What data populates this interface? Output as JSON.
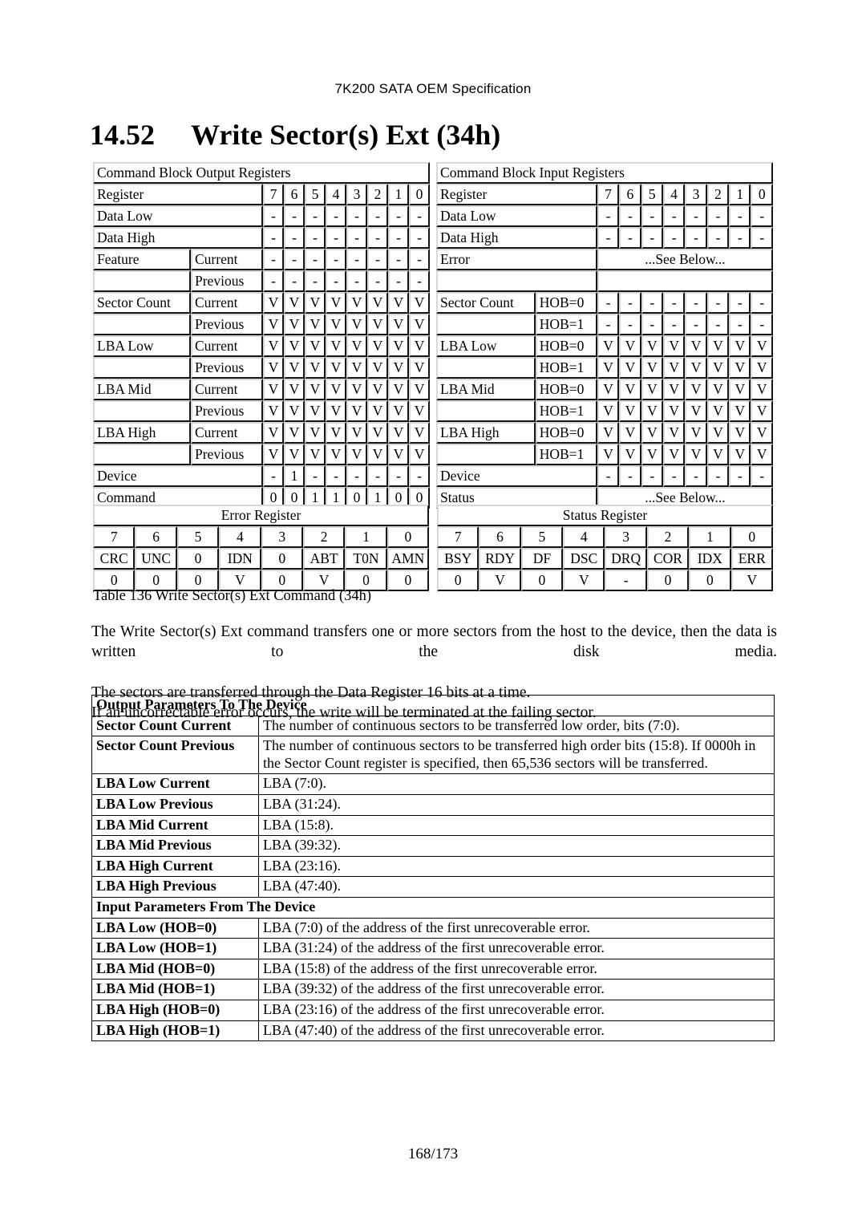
{
  "header": {
    "running_title": "7K200 SATA OEM Specification"
  },
  "title": {
    "number": "14.52",
    "text": "Write Sector(s) Ext (34h)"
  },
  "output_registers": {
    "caption": "Command Block Output Registers",
    "register_label": "Register",
    "bit_headers": [
      "7",
      "6",
      "5",
      "4",
      "3",
      "2",
      "1",
      "0"
    ],
    "rows": [
      {
        "name": "Data Low",
        "sub": "",
        "values": [
          "-",
          "-",
          "-",
          "-",
          "-",
          "-",
          "-",
          "-"
        ]
      },
      {
        "name": "Data High",
        "sub": "",
        "values": [
          "-",
          "-",
          "-",
          "-",
          "-",
          "-",
          "-",
          "-"
        ]
      },
      {
        "name": "Feature",
        "sub": "Current",
        "values": [
          "-",
          "-",
          "-",
          "-",
          "-",
          "-",
          "-",
          "-"
        ]
      },
      {
        "name": "",
        "sub": "Previous",
        "values": [
          "-",
          "-",
          "-",
          "-",
          "-",
          "-",
          "-",
          "-"
        ]
      },
      {
        "name": "Sector Count",
        "sub": "Current",
        "values": [
          "V",
          "V",
          "V",
          "V",
          "V",
          "V",
          "V",
          "V"
        ]
      },
      {
        "name": "",
        "sub": "Previous",
        "values": [
          "V",
          "V",
          "V",
          "V",
          "V",
          "V",
          "V",
          "V"
        ]
      },
      {
        "name": "LBA Low",
        "sub": "Current",
        "values": [
          "V",
          "V",
          "V",
          "V",
          "V",
          "V",
          "V",
          "V"
        ]
      },
      {
        "name": "",
        "sub": "Previous",
        "values": [
          "V",
          "V",
          "V",
          "V",
          "V",
          "V",
          "V",
          "V"
        ]
      },
      {
        "name": "LBA Mid",
        "sub": "Current",
        "values": [
          "V",
          "V",
          "V",
          "V",
          "V",
          "V",
          "V",
          "V"
        ]
      },
      {
        "name": "",
        "sub": "Previous",
        "values": [
          "V",
          "V",
          "V",
          "V",
          "V",
          "V",
          "V",
          "V"
        ]
      },
      {
        "name": "LBA High",
        "sub": "Current",
        "values": [
          "V",
          "V",
          "V",
          "V",
          "V",
          "V",
          "V",
          "V"
        ]
      },
      {
        "name": "",
        "sub": "Previous",
        "values": [
          "V",
          "V",
          "V",
          "V",
          "V",
          "V",
          "V",
          "V"
        ]
      },
      {
        "name": "Device",
        "sub": "",
        "values": [
          "-",
          "1",
          "-",
          "-",
          "-",
          "-",
          "-",
          "-"
        ]
      },
      {
        "name": "Command",
        "sub": "",
        "values": [
          "0",
          "0",
          "1",
          "1",
          "0",
          "1",
          "0",
          "0"
        ]
      }
    ]
  },
  "input_registers": {
    "caption": "Command Block Input Registers",
    "register_label": "Register",
    "bit_headers": [
      "7",
      "6",
      "5",
      "4",
      "3",
      "2",
      "1",
      "0"
    ],
    "see_below": "...See Below...",
    "rows": [
      {
        "name": "Data Low",
        "sub": "",
        "values": [
          "-",
          "-",
          "-",
          "-",
          "-",
          "-",
          "-",
          "-"
        ]
      },
      {
        "name": "Data High",
        "sub": "",
        "values": [
          "-",
          "-",
          "-",
          "-",
          "-",
          "-",
          "-",
          "-"
        ]
      },
      {
        "name": "Error",
        "sub": "",
        "span": "...See Below..."
      },
      {
        "name": "",
        "sub": "",
        "span": ""
      },
      {
        "name": "Sector Count",
        "sub": "HOB=0",
        "values": [
          "-",
          "-",
          "-",
          "-",
          "-",
          "-",
          "-",
          "-"
        ]
      },
      {
        "name": "",
        "sub": "HOB=1",
        "values": [
          "-",
          "-",
          "-",
          "-",
          "-",
          "-",
          "-",
          "-"
        ]
      },
      {
        "name": "LBA Low",
        "sub": "HOB=0",
        "values": [
          "V",
          "V",
          "V",
          "V",
          "V",
          "V",
          "V",
          "V"
        ]
      },
      {
        "name": "",
        "sub": "HOB=1",
        "values": [
          "V",
          "V",
          "V",
          "V",
          "V",
          "V",
          "V",
          "V"
        ]
      },
      {
        "name": "LBA Mid",
        "sub": "HOB=0",
        "values": [
          "V",
          "V",
          "V",
          "V",
          "V",
          "V",
          "V",
          "V"
        ]
      },
      {
        "name": "",
        "sub": "HOB=1",
        "values": [
          "V",
          "V",
          "V",
          "V",
          "V",
          "V",
          "V",
          "V"
        ]
      },
      {
        "name": "LBA High",
        "sub": "HOB=0",
        "values": [
          "V",
          "V",
          "V",
          "V",
          "V",
          "V",
          "V",
          "V"
        ]
      },
      {
        "name": "",
        "sub": "HOB=1",
        "values": [
          "V",
          "V",
          "V",
          "V",
          "V",
          "V",
          "V",
          "V"
        ]
      },
      {
        "name": "Device",
        "sub": "",
        "values": [
          "-",
          "-",
          "-",
          "-",
          "-",
          "-",
          "-",
          "-"
        ]
      },
      {
        "name": "Status",
        "sub": "",
        "span": "...See Below..."
      }
    ]
  },
  "error_register": {
    "title": "Error Register",
    "bits": [
      "7",
      "6",
      "5",
      "4",
      "3",
      "2",
      "1",
      "0"
    ],
    "names": [
      "CRC",
      "UNC",
      "0",
      "IDN",
      "0",
      "ABT",
      "T0N",
      "AMN"
    ],
    "values": [
      "0",
      "0",
      "0",
      "V",
      "0",
      "V",
      "0",
      "0"
    ]
  },
  "status_register": {
    "title": "Status Register",
    "bits": [
      "7",
      "6",
      "5",
      "4",
      "3",
      "2",
      "1",
      "0"
    ],
    "names": [
      "BSY",
      "RDY",
      "DF",
      "DSC",
      "DRQ",
      "COR",
      "IDX",
      "ERR"
    ],
    "values": [
      "0",
      "V",
      "0",
      "V",
      "-",
      "0",
      "0",
      "V"
    ]
  },
  "table_caption": "Table 136 Write Sector(s) Ext Command (34h)",
  "body": {
    "p1": "The Write Sector(s) Ext command transfers one or more sectors from the host to the device, then the data is written to the disk media.",
    "p2": "The sectors are transferred through the Data Register 16 bits at a time.",
    "p3": "If an uncorrectable error occurs, the write will be terminated at the failing sector."
  },
  "parameters": {
    "output_section": "Output Parameters To The Device",
    "output_rows": [
      {
        "key": "Sector Count Current",
        "val": "The number of continuous sectors to be transferred low order, bits (7:0)."
      },
      {
        "key": "Sector Count Previous",
        "val": "The number of continuous sectors to be transferred high order bits (15:8). If 0000h in the Sector Count register is specified, then 65,536 sectors will be transferred."
      },
      {
        "key": "LBA Low Current",
        "val": "LBA (7:0)."
      },
      {
        "key": "LBA Low Previous",
        "val": "LBA (31:24)."
      },
      {
        "key": "LBA Mid Current",
        "val": "LBA (15:8)."
      },
      {
        "key": "LBA Mid Previous",
        "val": "LBA (39:32)."
      },
      {
        "key": "LBA High Current",
        "val": "LBA (23:16)."
      },
      {
        "key": "LBA High Previous",
        "val": "LBA (47:40)."
      }
    ],
    "input_section": "Input Parameters From The Device",
    "input_rows": [
      {
        "key": "LBA Low (HOB=0)",
        "val": "LBA (7:0) of the address of the first unrecoverable error."
      },
      {
        "key": "LBA Low (HOB=1)",
        "val": "LBA (31:24) of the address of the first unrecoverable error."
      },
      {
        "key": "LBA Mid (HOB=0)",
        "val": "LBA (15:8) of the address of the first unrecoverable error."
      },
      {
        "key": "LBA Mid (HOB=1)",
        "val": "LBA (39:32) of the address of the first unrecoverable error."
      },
      {
        "key": "LBA High (HOB=0)",
        "val": "LBA (23:16) of the address of the first unrecoverable error."
      },
      {
        "key": "LBA High (HOB=1)",
        "val": "LBA (47:40) of the address of the first unrecoverable error."
      }
    ]
  },
  "footer": {
    "page_number": "168/173"
  }
}
